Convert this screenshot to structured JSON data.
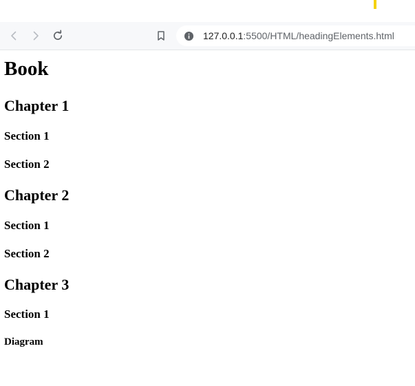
{
  "browser": {
    "url_host": "127.0.0.1",
    "url_path": ":5500/HTML/headingElements.html",
    "icons": {
      "back": "arrow-left-icon",
      "forward": "arrow-right-icon",
      "reload": "reload-icon",
      "bookmark": "bookmark-icon",
      "site_info": "info-icon"
    },
    "colors": {
      "toolbar": "#f7f8fa",
      "tab_accent": "#f5d20a"
    }
  },
  "page": {
    "title": "Book",
    "chapters": [
      {
        "heading": "Chapter 1",
        "sections": [
          "Section 1",
          "Section 2"
        ]
      },
      {
        "heading": "Chapter 2",
        "sections": [
          "Section 1",
          "Section 2"
        ]
      },
      {
        "heading": "Chapter 3",
        "sections": [
          "Section 1"
        ]
      }
    ],
    "diagram_label": "Diagram"
  }
}
